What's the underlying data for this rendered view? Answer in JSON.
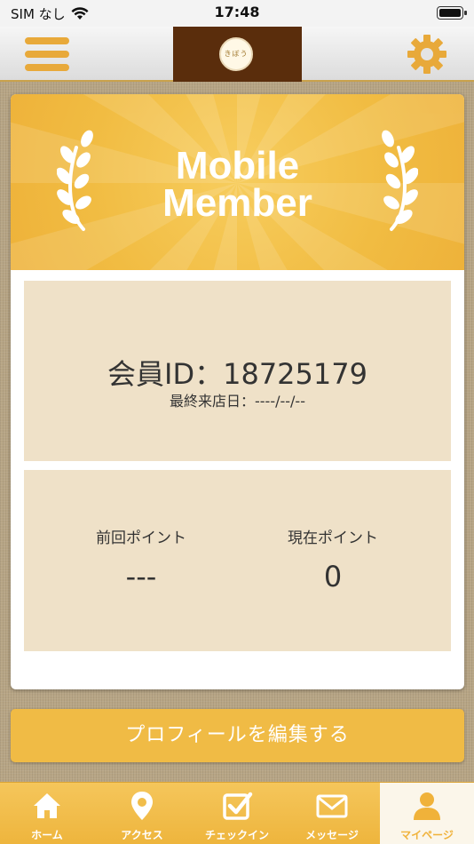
{
  "status_bar": {
    "carrier": "SIM なし",
    "time": "17:48"
  },
  "header": {
    "logo_text": "きぼう"
  },
  "banner": {
    "title_line1": "Mobile",
    "title_line2": "Member"
  },
  "member": {
    "id_text": "会員ID：18725179",
    "last_visit_text": "最終来店日：----/--/--"
  },
  "points": {
    "previous_label": "前回ポイント",
    "previous_value": "---",
    "current_label": "現在ポイント",
    "current_value": "0"
  },
  "edit_profile_label": "プロフィールを編集する",
  "tabs": [
    {
      "label": "ホーム",
      "icon": "home-icon"
    },
    {
      "label": "アクセス",
      "icon": "map-pin-icon"
    },
    {
      "label": "チェックイン",
      "icon": "checkbox-icon"
    },
    {
      "label": "メッセージ",
      "icon": "mail-icon"
    },
    {
      "label": "マイページ",
      "icon": "person-icon"
    }
  ],
  "colors": {
    "accent": "#f0bb45",
    "header_brand": "#5a2d0c",
    "panel": "#efe1c8"
  }
}
